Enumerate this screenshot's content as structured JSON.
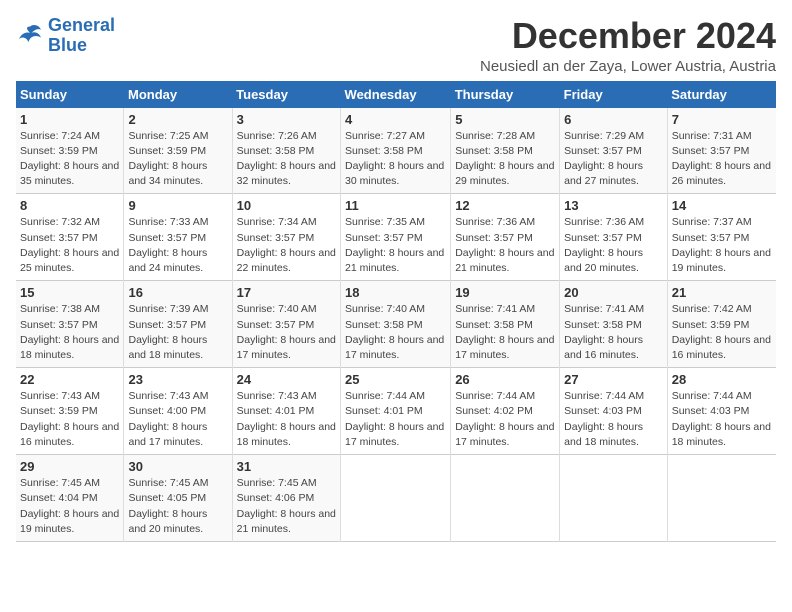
{
  "logo": {
    "line1": "General",
    "line2": "Blue"
  },
  "title": "December 2024",
  "subtitle": "Neusiedl an der Zaya, Lower Austria, Austria",
  "weekdays": [
    "Sunday",
    "Monday",
    "Tuesday",
    "Wednesday",
    "Thursday",
    "Friday",
    "Saturday"
  ],
  "weeks": [
    [
      {
        "day": "1",
        "sunrise": "7:24 AM",
        "sunset": "3:59 PM",
        "daylight": "8 hours and 35 minutes."
      },
      {
        "day": "2",
        "sunrise": "7:25 AM",
        "sunset": "3:59 PM",
        "daylight": "8 hours and 34 minutes."
      },
      {
        "day": "3",
        "sunrise": "7:26 AM",
        "sunset": "3:58 PM",
        "daylight": "8 hours and 32 minutes."
      },
      {
        "day": "4",
        "sunrise": "7:27 AM",
        "sunset": "3:58 PM",
        "daylight": "8 hours and 30 minutes."
      },
      {
        "day": "5",
        "sunrise": "7:28 AM",
        "sunset": "3:58 PM",
        "daylight": "8 hours and 29 minutes."
      },
      {
        "day": "6",
        "sunrise": "7:29 AM",
        "sunset": "3:57 PM",
        "daylight": "8 hours and 27 minutes."
      },
      {
        "day": "7",
        "sunrise": "7:31 AM",
        "sunset": "3:57 PM",
        "daylight": "8 hours and 26 minutes."
      }
    ],
    [
      {
        "day": "8",
        "sunrise": "7:32 AM",
        "sunset": "3:57 PM",
        "daylight": "8 hours and 25 minutes."
      },
      {
        "day": "9",
        "sunrise": "7:33 AM",
        "sunset": "3:57 PM",
        "daylight": "8 hours and 24 minutes."
      },
      {
        "day": "10",
        "sunrise": "7:34 AM",
        "sunset": "3:57 PM",
        "daylight": "8 hours and 22 minutes."
      },
      {
        "day": "11",
        "sunrise": "7:35 AM",
        "sunset": "3:57 PM",
        "daylight": "8 hours and 21 minutes."
      },
      {
        "day": "12",
        "sunrise": "7:36 AM",
        "sunset": "3:57 PM",
        "daylight": "8 hours and 21 minutes."
      },
      {
        "day": "13",
        "sunrise": "7:36 AM",
        "sunset": "3:57 PM",
        "daylight": "8 hours and 20 minutes."
      },
      {
        "day": "14",
        "sunrise": "7:37 AM",
        "sunset": "3:57 PM",
        "daylight": "8 hours and 19 minutes."
      }
    ],
    [
      {
        "day": "15",
        "sunrise": "7:38 AM",
        "sunset": "3:57 PM",
        "daylight": "8 hours and 18 minutes."
      },
      {
        "day": "16",
        "sunrise": "7:39 AM",
        "sunset": "3:57 PM",
        "daylight": "8 hours and 18 minutes."
      },
      {
        "day": "17",
        "sunrise": "7:40 AM",
        "sunset": "3:57 PM",
        "daylight": "8 hours and 17 minutes."
      },
      {
        "day": "18",
        "sunrise": "7:40 AM",
        "sunset": "3:58 PM",
        "daylight": "8 hours and 17 minutes."
      },
      {
        "day": "19",
        "sunrise": "7:41 AM",
        "sunset": "3:58 PM",
        "daylight": "8 hours and 17 minutes."
      },
      {
        "day": "20",
        "sunrise": "7:41 AM",
        "sunset": "3:58 PM",
        "daylight": "8 hours and 16 minutes."
      },
      {
        "day": "21",
        "sunrise": "7:42 AM",
        "sunset": "3:59 PM",
        "daylight": "8 hours and 16 minutes."
      }
    ],
    [
      {
        "day": "22",
        "sunrise": "7:43 AM",
        "sunset": "3:59 PM",
        "daylight": "8 hours and 16 minutes."
      },
      {
        "day": "23",
        "sunrise": "7:43 AM",
        "sunset": "4:00 PM",
        "daylight": "8 hours and 17 minutes."
      },
      {
        "day": "24",
        "sunrise": "7:43 AM",
        "sunset": "4:01 PM",
        "daylight": "8 hours and 18 minutes."
      },
      {
        "day": "25",
        "sunrise": "7:44 AM",
        "sunset": "4:01 PM",
        "daylight": "8 hours and 17 minutes."
      },
      {
        "day": "26",
        "sunrise": "7:44 AM",
        "sunset": "4:02 PM",
        "daylight": "8 hours and 17 minutes."
      },
      {
        "day": "27",
        "sunrise": "7:44 AM",
        "sunset": "4:03 PM",
        "daylight": "8 hours and 18 minutes."
      },
      {
        "day": "28",
        "sunrise": "7:44 AM",
        "sunset": "4:03 PM",
        "daylight": "8 hours and 18 minutes."
      }
    ],
    [
      {
        "day": "29",
        "sunrise": "7:45 AM",
        "sunset": "4:04 PM",
        "daylight": "8 hours and 19 minutes."
      },
      {
        "day": "30",
        "sunrise": "7:45 AM",
        "sunset": "4:05 PM",
        "daylight": "8 hours and 20 minutes."
      },
      {
        "day": "31",
        "sunrise": "7:45 AM",
        "sunset": "4:06 PM",
        "daylight": "8 hours and 21 minutes."
      },
      null,
      null,
      null,
      null
    ]
  ]
}
